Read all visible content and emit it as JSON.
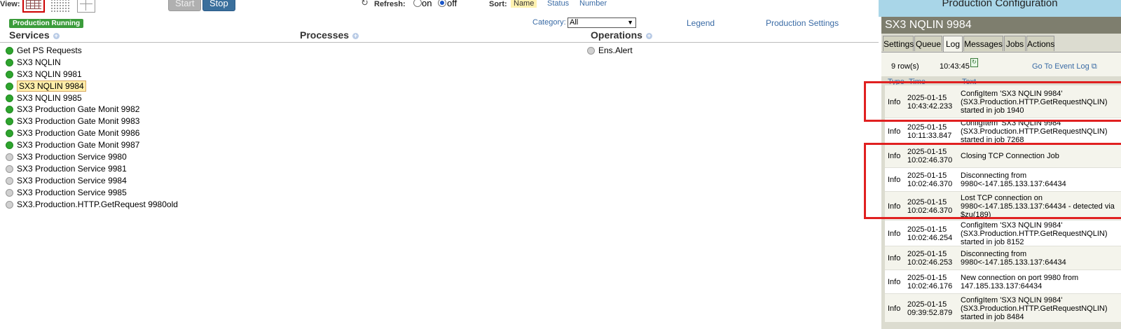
{
  "toolbar": {
    "view_label": "View:",
    "start_label": "Start",
    "stop_label": "Stop",
    "refresh_label": "Refresh:",
    "refresh_on": "on",
    "refresh_off": "off",
    "sort_label": "Sort:",
    "sort_name": "Name",
    "sort_status": "Status",
    "sort_number": "Number"
  },
  "status_badge": "Production Running",
  "category_label": "Category:",
  "category_value": "All",
  "legend_link": "Legend",
  "production_settings_link": "Production Settings",
  "columns": {
    "services": "Services",
    "processes": "Processes",
    "operations": "Operations"
  },
  "services": [
    {
      "name": "Get PS Requests",
      "status": "green"
    },
    {
      "name": "SX3 NQLIN",
      "status": "green"
    },
    {
      "name": "SX3 NQLIN 9981",
      "status": "green"
    },
    {
      "name": "SX3 NQLIN 9984",
      "status": "green",
      "selected": true
    },
    {
      "name": "SX3 NQLIN 9985",
      "status": "green"
    },
    {
      "name": "SX3 Production Gate Monit 9982",
      "status": "green"
    },
    {
      "name": "SX3 Production Gate Monit 9983",
      "status": "green"
    },
    {
      "name": "SX3 Production Gate Monit 9986",
      "status": "green"
    },
    {
      "name": "SX3 Production Gate Monit 9987",
      "status": "green"
    },
    {
      "name": "SX3 Production Service 9980",
      "status": "gray"
    },
    {
      "name": "SX3 Production Service 9981",
      "status": "gray"
    },
    {
      "name": "SX3 Production Service 9984",
      "status": "gray"
    },
    {
      "name": "SX3 Production Service 9985",
      "status": "gray"
    },
    {
      "name": "SX3.Production.HTTP.GetRequest 9980old",
      "status": "gray"
    }
  ],
  "operations": [
    {
      "name": "Ens.Alert",
      "status": "gray"
    }
  ],
  "panel": {
    "banner": "Production Configuration",
    "title": "SX3 NQLIN 9984",
    "tabs": [
      "Settings",
      "Queue",
      "Log",
      "Messages",
      "Jobs",
      "Actions"
    ],
    "active_tab": "Log",
    "rows_count": "9 row(s)",
    "time": "10:43:45",
    "event_log_link": "Go To Event Log",
    "headers": [
      "Type",
      "Time",
      "Text"
    ]
  },
  "log_rows": [
    {
      "type": "Info",
      "time": "2025-01-15 10:43:42.233",
      "text": "ConfigItem 'SX3 NQLIN 9984' (SX3.Production.HTTP.GetRequestNQLIN) started in job 1940"
    },
    {
      "type": "Info",
      "time": "2025-01-15 10:11:33.847",
      "text": "ConfigItem 'SX3 NQLIN 9984' (SX3.Production.HTTP.GetRequestNQLIN) started in job 7268"
    },
    {
      "type": "Info",
      "time": "2025-01-15 10:02:46.370",
      "text": "Closing TCP Connection Job"
    },
    {
      "type": "Info",
      "time": "2025-01-15 10:02:46.370",
      "text": "Disconnecting from 9980<-147.185.133.137:64434"
    },
    {
      "type": "Info",
      "time": "2025-01-15 10:02:46.370",
      "text": "Lost TCP connection on 9980<-147.185.133.137:64434 - detected via $zu(189)"
    },
    {
      "type": "Info",
      "time": "2025-01-15 10:02:46.254",
      "text": "ConfigItem 'SX3 NQLIN 9984' (SX3.Production.HTTP.GetRequestNQLIN) started in job 8152"
    },
    {
      "type": "Info",
      "time": "2025-01-15 10:02:46.253",
      "text": "Disconnecting from 9980<-147.185.133.137:64434"
    },
    {
      "type": "Info",
      "time": "2025-01-15 10:02:46.176",
      "text": "New connection on port 9980 from 147.185.133.137:64434"
    },
    {
      "type": "Info",
      "time": "2025-01-15 09:39:52.879",
      "text": "ConfigItem 'SX3 NQLIN 9984' (SX3.Production.HTTP.GetRequestNQLIN) started in job 8484"
    }
  ]
}
